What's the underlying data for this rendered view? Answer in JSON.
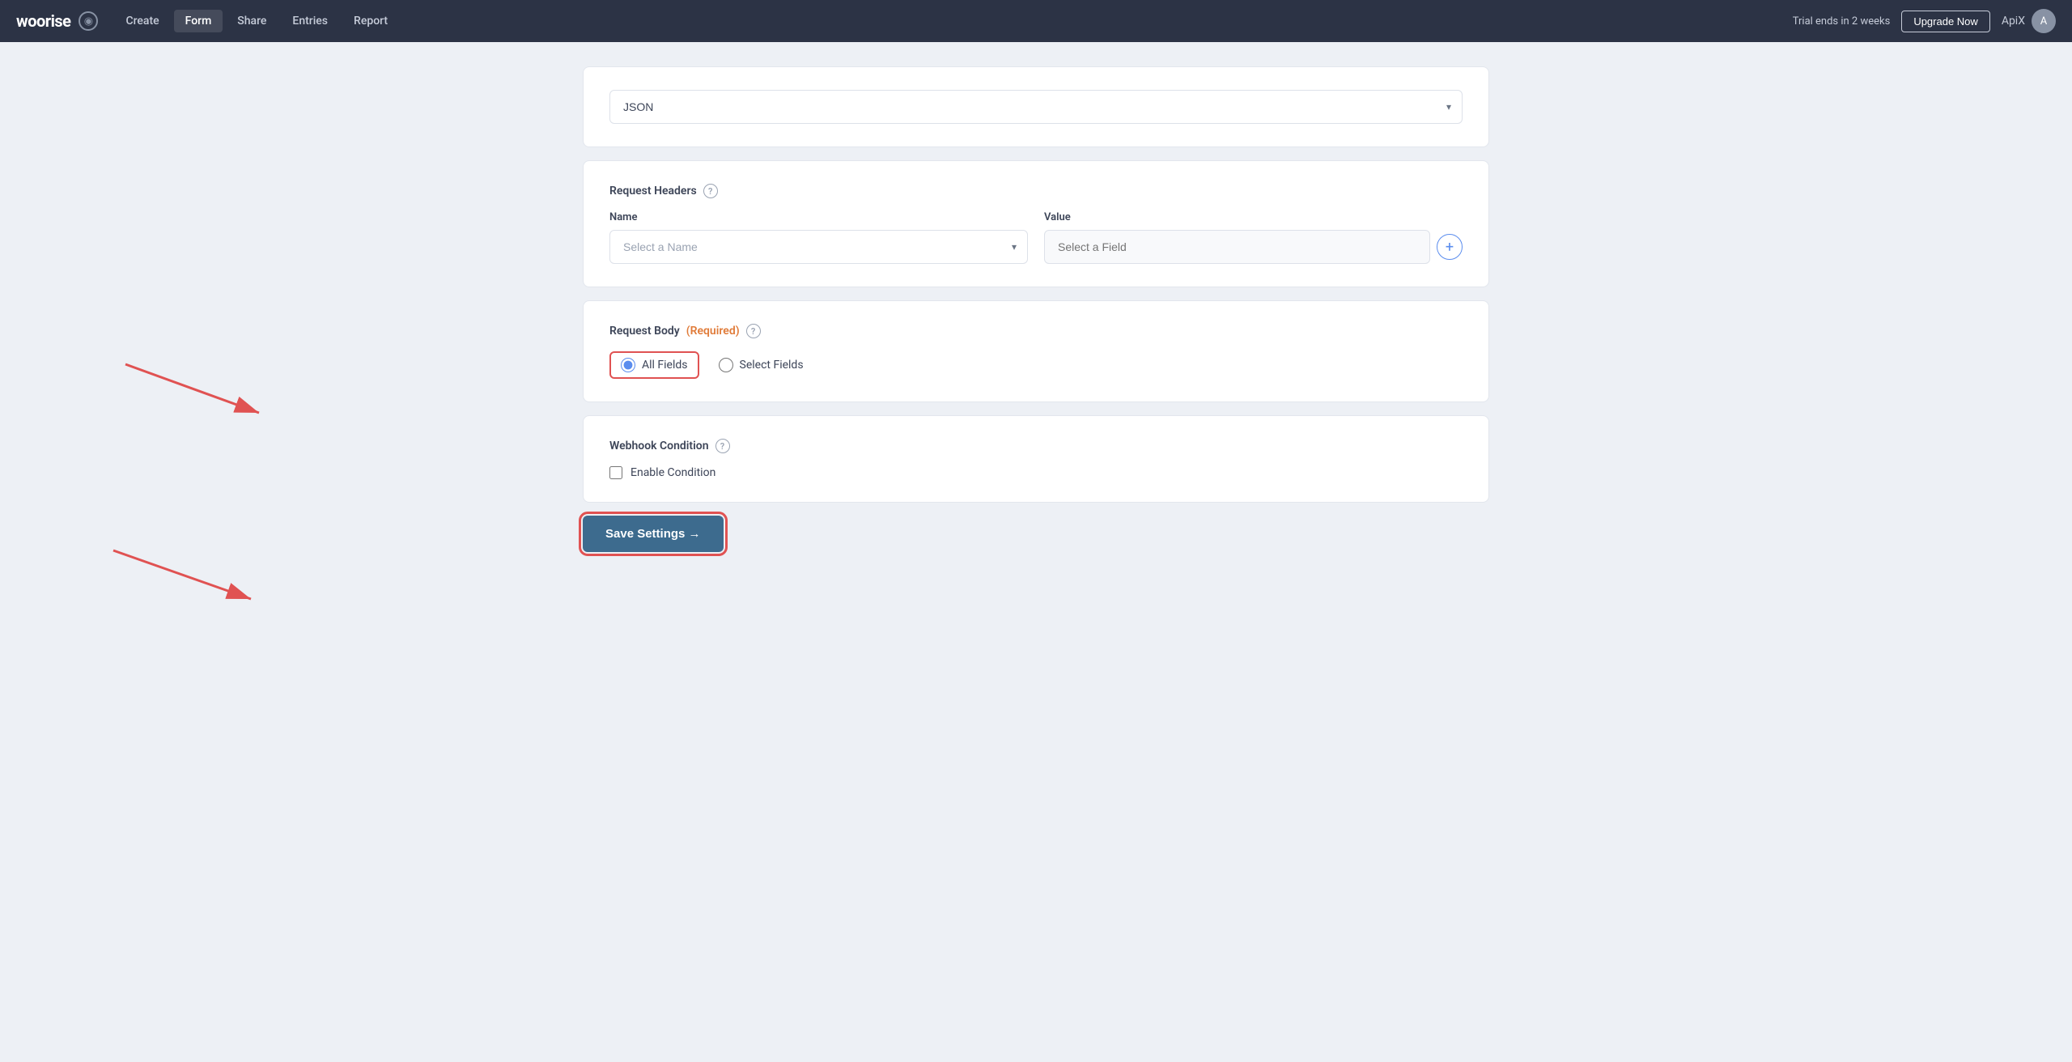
{
  "navbar": {
    "brand": "woorise",
    "globe_icon": "●",
    "nav_items": [
      {
        "label": "Create",
        "active": false
      },
      {
        "label": "Form",
        "active": true
      },
      {
        "label": "Share",
        "active": false
      },
      {
        "label": "Entries",
        "active": false
      },
      {
        "label": "Report",
        "active": false
      }
    ],
    "trial_text": "Trial ends in 2 weeks",
    "upgrade_label": "Upgrade Now",
    "username": "ApiX"
  },
  "json_card": {
    "value": "JSON"
  },
  "request_headers": {
    "title": "Request Headers",
    "name_label": "Name",
    "name_placeholder": "Select a Name",
    "value_label": "Value",
    "value_placeholder": "Select a Field",
    "add_icon": "+"
  },
  "request_body": {
    "title": "Request Body",
    "required_label": "(Required)",
    "all_fields_label": "All Fields",
    "select_fields_label": "Select Fields",
    "selected": "all_fields"
  },
  "webhook_condition": {
    "title": "Webhook Condition",
    "enable_label": "Enable Condition",
    "checked": false
  },
  "save_settings": {
    "label": "Save Settings →"
  }
}
